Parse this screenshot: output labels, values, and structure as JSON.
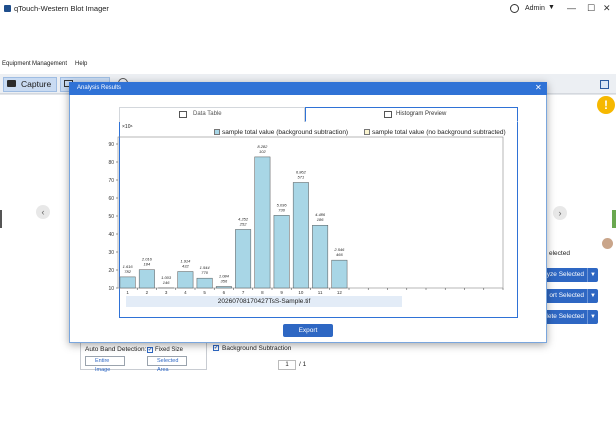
{
  "app": {
    "title": "qTouch-Western Blot Imager",
    "user": "Admin"
  },
  "menu": [
    "Equipment",
    "Management",
    "Help"
  ],
  "toolbar": {
    "capture": "Capture"
  },
  "background": {
    "selected_text": "elected",
    "buttons": [
      "alyze Selected",
      "ort Selected",
      "lete Selected"
    ],
    "auto_band_detection": "Auto Band Detection:",
    "fixed_size": "Fixed Size",
    "entire_image": "Entire Image",
    "selected_area": "Selected Area",
    "background_subtraction": "Background Subtraction",
    "page_current": "1",
    "page_total": "/ 1"
  },
  "dialog": {
    "title": "Analysis Results",
    "tabs": [
      "Data Table",
      "Histogram Preview"
    ],
    "active_tab": "Histogram Preview",
    "export": "Export"
  },
  "colors": {
    "accent": "#2f72d6",
    "bar": "#a8d6e6",
    "bar2": "#fbf5d0",
    "warning": "#f6b800"
  },
  "chart_data": {
    "type": "bar",
    "categories": [
      "1",
      "2",
      "3",
      "4",
      "5",
      "6",
      "7",
      "8",
      "9",
      "10",
      "11",
      "12"
    ],
    "series": [
      {
        "name": "sample total value (background subtraction)",
        "values": [
          1.616782,
          2.016184,
          1.003146,
          1.914432,
          1.54477,
          1.084356,
          4.252252,
          8.282102,
          5.03673,
          6.862571,
          4.486186,
          2.546466
        ],
        "labels": [
          "1.616\n782",
          "2.016\n184",
          "1.003\n146",
          "1.914\n432",
          "1.544\n770",
          "1.084\n356",
          "4.252\n252",
          "8.282\n102",
          "5.036\n730",
          "6.862\n571",
          "4.486\n186",
          "2.546\n466"
        ]
      },
      {
        "name": "sample total value (no background subtracted)",
        "values": []
      }
    ],
    "yunit": "×10⁶",
    "yticks": [
      10,
      20,
      30,
      40,
      50,
      60,
      70,
      80,
      90
    ],
    "ylim": [
      10,
      90
    ],
    "xlabel": "20260708170427TsS-Sample.tif",
    "legend": "top"
  }
}
